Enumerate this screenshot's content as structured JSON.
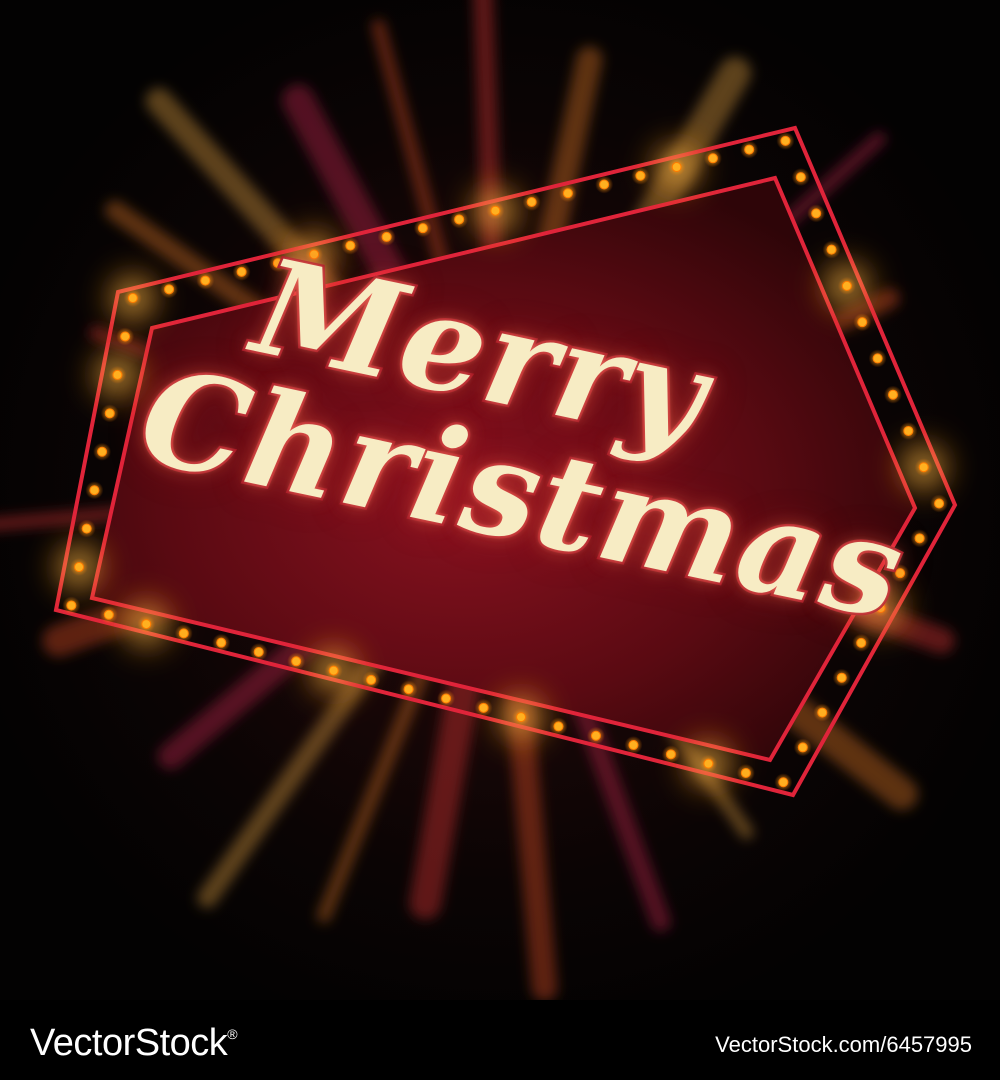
{
  "sign": {
    "line1": "Merry",
    "line2": "Christmas"
  },
  "footer": {
    "brand": "VectorStock",
    "registered_mark": "®",
    "image_id": "VectorStock.com/6457995"
  },
  "colors": {
    "background": "#050404",
    "sign_fill": "#5a0a12",
    "frame_outline": "#e0243a",
    "bulb": "#ffb020",
    "lettering": "#f7ecc4",
    "lettering_outline": "#a01626"
  }
}
